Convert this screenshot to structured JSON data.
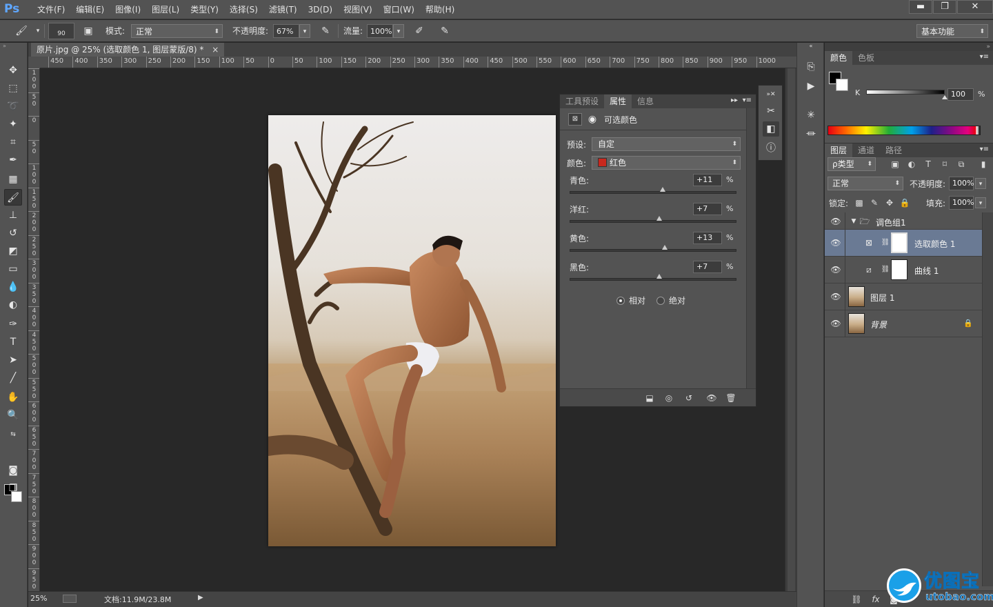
{
  "app": {
    "logo": "Ps",
    "menu": [
      "文件(F)",
      "编辑(E)",
      "图像(I)",
      "图层(L)",
      "类型(Y)",
      "选择(S)",
      "滤镜(T)",
      "3D(D)",
      "视图(V)",
      "窗口(W)",
      "帮助(H)"
    ],
    "window_controls": {
      "minimize": "▬",
      "restore": "❐",
      "close": "✕"
    }
  },
  "options_bar": {
    "brush_size": "90",
    "mode_label": "模式:",
    "mode_value": "正常",
    "opacity_label": "不透明度:",
    "opacity_value": "67%",
    "flow_label": "流量:",
    "flow_value": "100%",
    "workspace": "基本功能"
  },
  "document": {
    "tab_title": "原片.jpg @ 25% (选取颜色 1, 图层蒙版/8) *",
    "tab_close": "×",
    "zoom": "25%",
    "doc_info": "文档:11.9M/23.8M"
  },
  "ruler": {
    "horizontal": [
      "450",
      "400",
      "350",
      "300",
      "250",
      "200",
      "150",
      "100",
      "50",
      "0",
      "50",
      "100",
      "150",
      "200",
      "250",
      "300",
      "350",
      "400",
      "450",
      "500",
      "550",
      "600",
      "650",
      "700",
      "750",
      "800",
      "850",
      "900",
      "950",
      "1000"
    ],
    "vertical": [
      "1 0 0",
      "5 0",
      "0",
      "5 0",
      "1 0 0",
      "1 5 0",
      "2 0 0",
      "2 5 0",
      "3 0 0",
      "3 5 0",
      "4 0 0",
      "4 5 0",
      "5 0 0",
      "5 5 0",
      "6 0 0",
      "6 5 0",
      "7 0 0",
      "7 5 0",
      "8 0 0",
      "8 5 0",
      "9 0 0",
      "9 5 0"
    ]
  },
  "properties_panel": {
    "tabs": [
      "工具预设",
      "属性",
      "信息"
    ],
    "active_tab": "属性",
    "title": "可选颜色",
    "preset_label": "预设:",
    "preset_value": "自定",
    "color_label": "颜色:",
    "color_value": "红色",
    "color_swatch": "#c8281e",
    "sliders": [
      {
        "name": "青色:",
        "value": "+11",
        "pct": "%",
        "position": 0.555
      },
      {
        "name": "洋红:",
        "value": "+7",
        "pct": "%",
        "position": 0.535
      },
      {
        "name": "黄色:",
        "value": "+13",
        "pct": "%",
        "position": 0.565
      },
      {
        "name": "黑色:",
        "value": "+7",
        "pct": "%",
        "position": 0.535
      }
    ],
    "method_relative": "相对",
    "method_absolute": "绝对",
    "method_selected": "relative"
  },
  "color_panel": {
    "tabs": [
      "颜色",
      "色板"
    ],
    "active_tab": "颜色",
    "channel": "K",
    "value": "100",
    "pct": "%"
  },
  "layers_panel": {
    "tabs": [
      "图层",
      "通道",
      "路径"
    ],
    "active_tab": "图层",
    "filter_label": "ρ类型",
    "blend_mode": "正常",
    "opacity_label": "不透明度:",
    "opacity_value": "100%",
    "lock_label": "锁定:",
    "fill_label": "填充:",
    "fill_value": "100%",
    "layers": [
      {
        "name": "调色组1",
        "type": "group",
        "expanded": true
      },
      {
        "name": "选取颜色 1",
        "type": "adjustment",
        "selected": true
      },
      {
        "name": "曲线 1",
        "type": "adjustment"
      },
      {
        "name": "图层 1",
        "type": "pixel"
      },
      {
        "name": "背景",
        "type": "background",
        "locked": true
      }
    ],
    "footer_fx": "fx"
  },
  "watermark": {
    "title": "优图宝",
    "url": "utobao.com"
  },
  "colors": {
    "panel_bg": "#535353",
    "canvas_bg": "#282828",
    "selected_layer": "#6a7a94"
  }
}
